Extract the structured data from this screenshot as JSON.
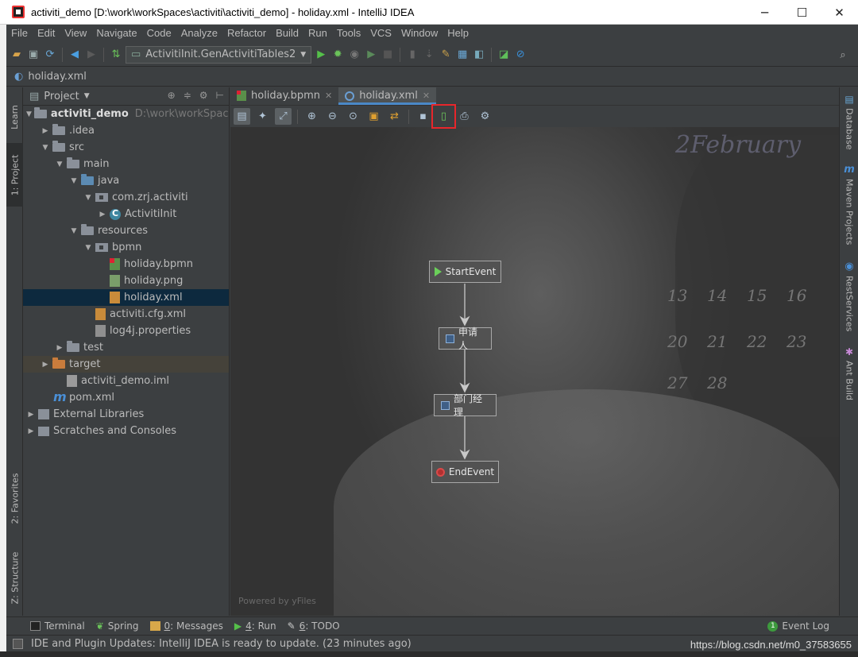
{
  "window": {
    "title": "activiti_demo [D:\\work\\workSpaces\\activiti\\activiti_demo] - holiday.xml - IntelliJ IDEA",
    "minimize": "─",
    "maximize": "☐",
    "close": "✕"
  },
  "menu": [
    "File",
    "Edit",
    "View",
    "Navigate",
    "Code",
    "Analyze",
    "Refactor",
    "Build",
    "Run",
    "Tools",
    "VCS",
    "Window",
    "Help"
  ],
  "toolbar": {
    "run_config": "ActivitiInit.GenActivitiTables2"
  },
  "breadcrumb": "holiday.xml",
  "left_stripe": {
    "learn": "Learn",
    "project": "1: Project",
    "favorites": "2: Favorites",
    "structure": "Z: Structure"
  },
  "right_stripe": {
    "database": "Database",
    "maven": "Maven Projects",
    "rest": "RestServices",
    "ant": "Ant Build"
  },
  "project_panel": {
    "title": "Project",
    "tree": [
      {
        "label": "activiti_demo",
        "hint": "D:\\work\\workSpaces\\ac"
      },
      {
        "label": ".idea"
      },
      {
        "label": "src"
      },
      {
        "label": "main"
      },
      {
        "label": "java"
      },
      {
        "label": "com.zrj.activiti"
      },
      {
        "label": "ActivitiInit"
      },
      {
        "label": "resources"
      },
      {
        "label": "bpmn"
      },
      {
        "label": "holiday.bpmn"
      },
      {
        "label": "holiday.png"
      },
      {
        "label": "holiday.xml"
      },
      {
        "label": "activiti.cfg.xml"
      },
      {
        "label": "log4j.properties"
      },
      {
        "label": "test"
      },
      {
        "label": "target"
      },
      {
        "label": "activiti_demo.iml"
      },
      {
        "label": "pom.xml"
      },
      {
        "label": "External Libraries"
      },
      {
        "label": "Scratches and Consoles"
      }
    ]
  },
  "editor": {
    "tabs": [
      {
        "label": "holiday.bpmn"
      },
      {
        "label": "holiday.xml"
      }
    ],
    "powered_by": "Powered by yFiles",
    "nodes": {
      "start": "StartEvent",
      "applicant": "申请人",
      "manager": "部门经理",
      "end": "EndEvent"
    },
    "calendar": {
      "month": "2February",
      "days": [
        "13",
        "14",
        "15",
        "16",
        "20",
        "21",
        "22",
        "23",
        "27",
        "28"
      ]
    }
  },
  "bottom_tools": {
    "terminal": "Terminal",
    "spring": "Spring",
    "messages_num": "0",
    "messages": ": Messages",
    "run_num": "4",
    "run": ": Run",
    "todo_num": "6",
    "todo": ": TODO",
    "event_log": "Event Log"
  },
  "status": {
    "message": "IDE and Plugin Updates: IntelliJ IDEA is ready to update. (23 minutes ago)",
    "watermark": "https://blog.csdn.net/m0_37583655"
  },
  "colors": {
    "highlight_red": "#e8262b",
    "selection": "#0d293e",
    "tab_underline": "#4a88c7"
  }
}
